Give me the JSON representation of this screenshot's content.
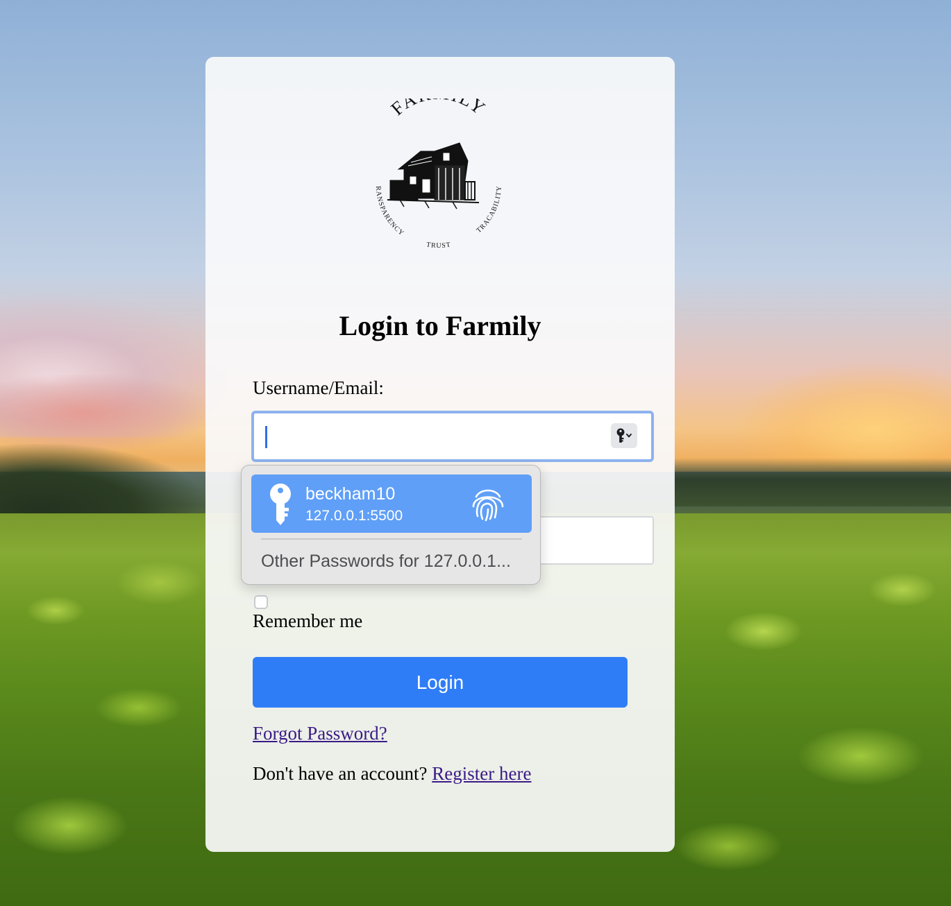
{
  "logo": {
    "brand": "FARMILY",
    "motto_left": "TRANSPARENCY",
    "motto_center": "TRUST",
    "motto_right": "TRACABILITY"
  },
  "login_form": {
    "title": "Login to Farmily",
    "username_label": "Username/Email:",
    "username_value": "",
    "password_value": "",
    "remember_label": "Remember me",
    "remember_checked": false,
    "submit_label": "Login",
    "forgot_label": "Forgot Password?",
    "no_account_text": "Don't have an account?",
    "register_label": "Register here"
  },
  "autofill_popup": {
    "saved_username": "beckham10",
    "saved_host": "127.0.0.1:5500",
    "other_passwords_label": "Other Passwords for 127.0.0.1..."
  },
  "icons": [
    "key-icon",
    "fingerprint-icon",
    "password-key-dropdown-icon"
  ],
  "colors": {
    "primary_button": "#2f7df6",
    "autofill_highlight": "#5f9ff7",
    "link": "#3b1a86",
    "focus_ring": "#8eb2ee"
  }
}
